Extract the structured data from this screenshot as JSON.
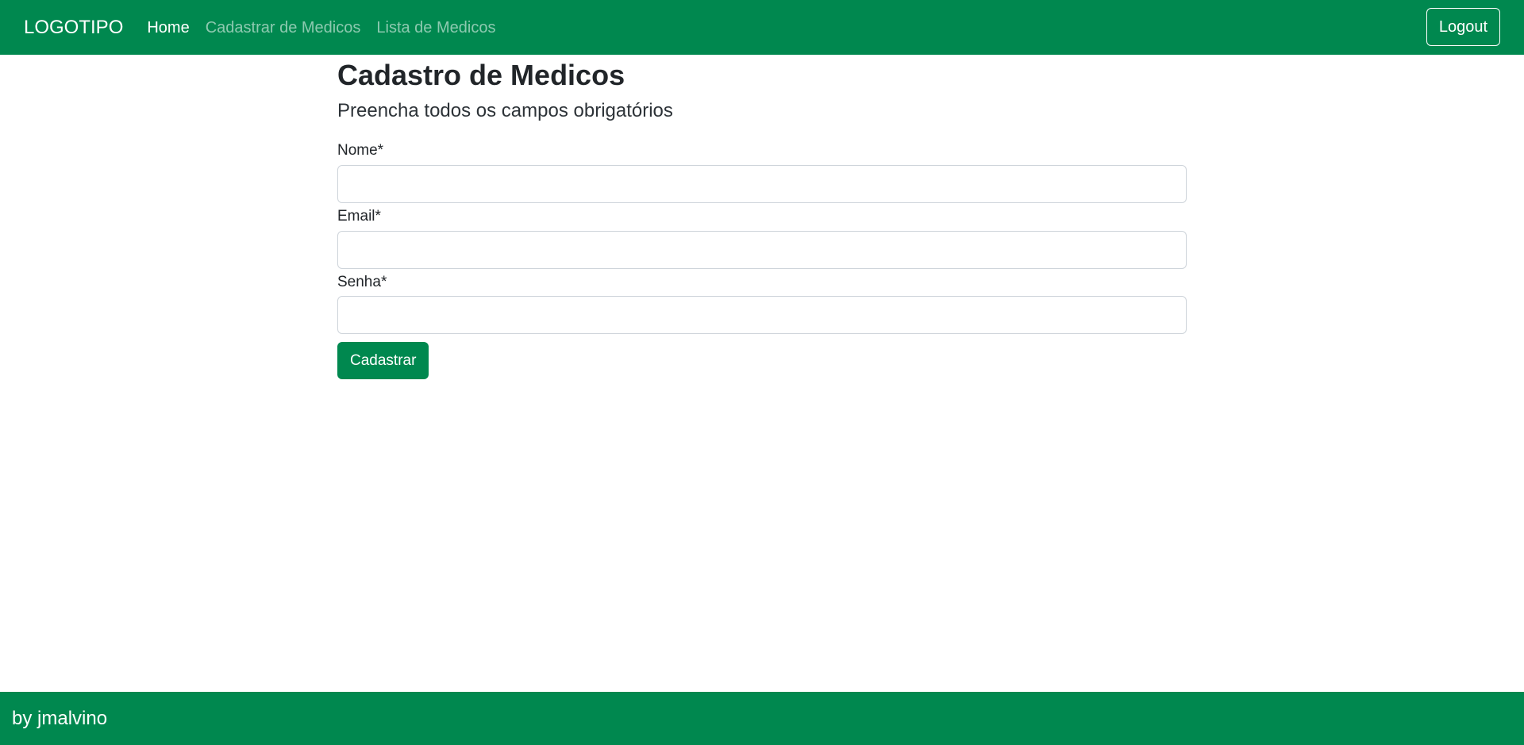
{
  "navbar": {
    "brand": "LOGOTIPO",
    "links": [
      {
        "label": "Home",
        "active": true
      },
      {
        "label": "Cadastrar de Medicos",
        "active": false
      },
      {
        "label": "Lista de Medicos",
        "active": false
      }
    ],
    "logout_label": "Logout"
  },
  "main": {
    "title": "Cadastro de Medicos",
    "subtitle": "Preencha todos os campos obrigatórios",
    "fields": [
      {
        "label": "Nome*",
        "value": "",
        "placeholder": ""
      },
      {
        "label": "Email*",
        "value": "",
        "placeholder": ""
      },
      {
        "label": "Senha*",
        "value": "",
        "placeholder": ""
      }
    ],
    "submit_label": "Cadastrar"
  },
  "footer": {
    "text": "by jmalvino"
  },
  "colors": {
    "brand_green": "#00884f",
    "text": "#212529",
    "input_border": "#ced4da"
  }
}
